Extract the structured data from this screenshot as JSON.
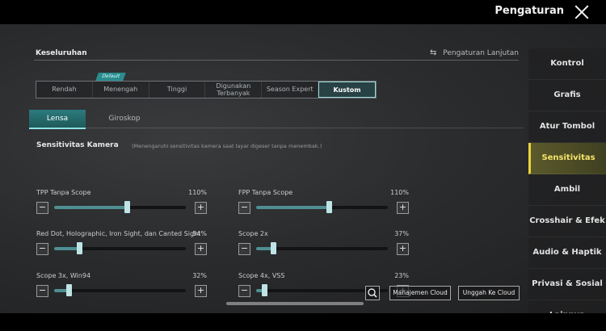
{
  "header": {
    "title": "Pengaturan"
  },
  "sidebar": {
    "items": [
      {
        "label": "Kontrol"
      },
      {
        "label": "Grafis"
      },
      {
        "label": "Atur Tombol"
      },
      {
        "label": "Sensitivitas"
      },
      {
        "label": "Ambil"
      },
      {
        "label": "Crosshair & Efek"
      },
      {
        "label": "Audio & Haptik"
      },
      {
        "label": "Privasi & Sosial"
      },
      {
        "label": "Lainnya"
      }
    ],
    "active_index": 3
  },
  "section": {
    "title": "Keseluruhan",
    "advanced_label": "Pengaturan Lanjutan",
    "advanced_icon": "swap-arrows-icon"
  },
  "presets": {
    "default_tag": "Default",
    "items": [
      "Rendah",
      "Menengah",
      "Tinggi",
      "Digunakan\nTerbanyak",
      "Season Expert",
      "Kustom"
    ],
    "active": "Kustom"
  },
  "tabs": {
    "items": [
      "Lensa",
      "Giroskop"
    ],
    "active": "Lensa"
  },
  "sensitivity": {
    "title": "Sensitivitas Kamera",
    "description": "(Menengaruhi sensitivitas kamera saat layar digeser tanpa menembak.)",
    "sliders": [
      {
        "label": "TPP Tanpa Scope",
        "value": "110%",
        "fill": 0.55
      },
      {
        "label": "FPP Tanpa Scope",
        "value": "110%",
        "fill": 0.55
      },
      {
        "label": "Red Dot, Holographic, Iron Sight, dan Canted Sight",
        "value": "54%",
        "fill": 0.19
      },
      {
        "label": "Scope 2x",
        "value": "37%",
        "fill": 0.13
      },
      {
        "label": "Scope 3x, Win94",
        "value": "32%",
        "fill": 0.11
      },
      {
        "label": "Scope 4x, VSS",
        "value": "23%",
        "fill": 0.06
      }
    ]
  },
  "footer": {
    "search_icon": "search-icon",
    "cloud_manage": "Manajemen Cloud",
    "cloud_upload": "Unggah Ke Cloud"
  },
  "colors": {
    "accent": "#36b8b8",
    "active_tab": "#e9d23c"
  }
}
